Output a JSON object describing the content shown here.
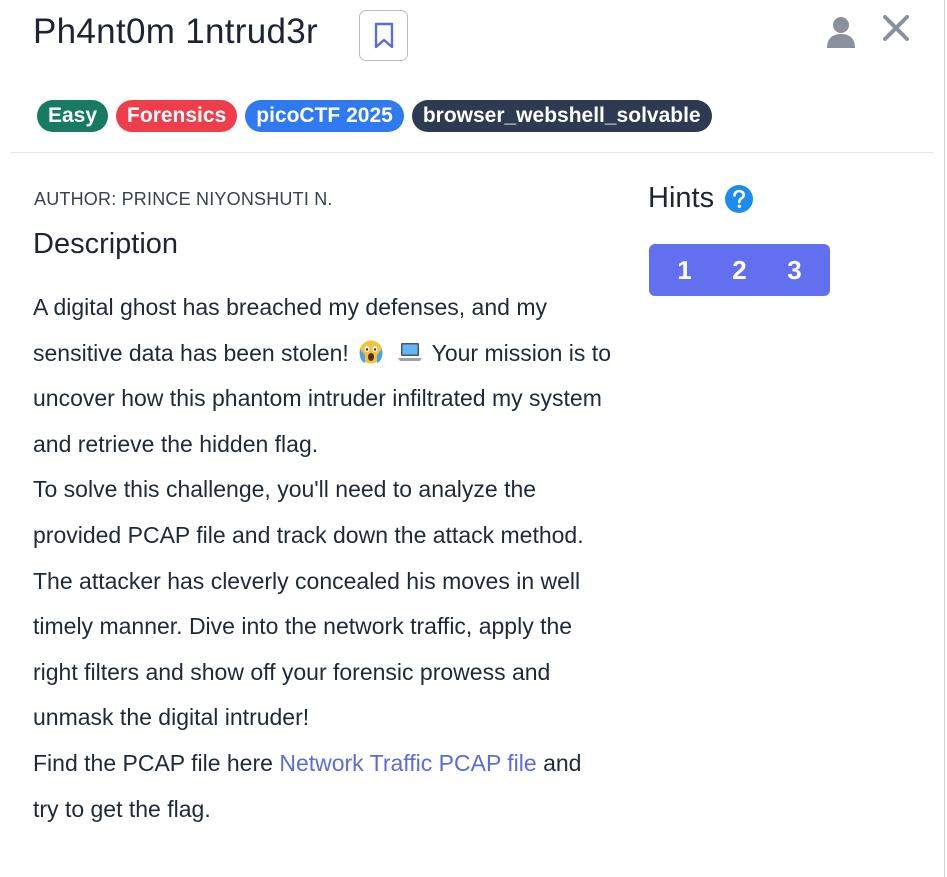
{
  "challenge": {
    "title": "Ph4nt0m 1ntrud3r",
    "tags": [
      {
        "label": "Easy",
        "color": "#177a62"
      },
      {
        "label": "Forensics",
        "color": "#ef3d4c"
      },
      {
        "label": "picoCTF 2025",
        "color": "#2f7af0"
      },
      {
        "label": "browser_webshell_solvable",
        "color": "#2d3a52"
      }
    ],
    "author": "AUTHOR: PRINCE NIYONSHUTI N.",
    "description_heading": "Description",
    "description": {
      "p1_before_emoji": "A digital ghost has breached my defenses, and my sensitive data has been stolen!",
      "p1_after_emoji": "Your mission is to uncover how this phantom intruder infiltrated my system and retrieve the hidden flag.",
      "p2": "To solve this challenge, you'll need to analyze the provided PCAP file and track down the attack method. The attacker has cleverly concealed his moves in well timely manner. Dive into the network traffic, apply the right filters and show off your forensic prowess and unmask the digital intruder!",
      "p3_before_link": "Find the PCAP file here",
      "p3_link": "Network Traffic PCAP file",
      "p3_after_link": "and try to get the flag."
    },
    "emojis": [
      "scream-emoji",
      "laptop-emoji"
    ]
  },
  "hints": {
    "title": "Hints",
    "items": [
      "1",
      "2",
      "3"
    ]
  },
  "colors": {
    "accent": "#6270f0",
    "link": "#5b6be0",
    "help": "#1d8bf0"
  },
  "icons": [
    "bookmark-icon",
    "user-icon",
    "close-icon",
    "help-icon"
  ]
}
